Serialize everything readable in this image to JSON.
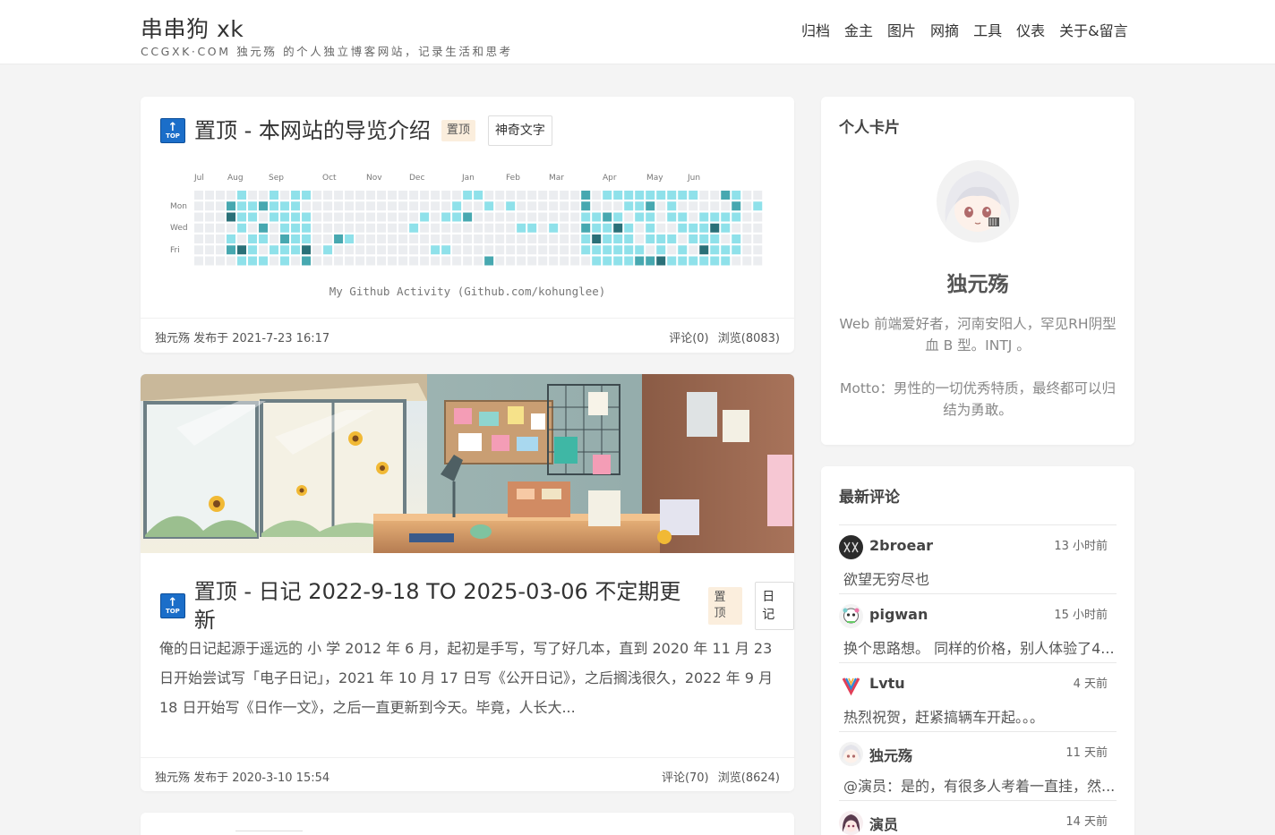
{
  "header": {
    "title": "串串狗 xk",
    "description": "CCGXK·COM 独元殇 的个人独立博客网站，记录生活和思考",
    "nav": [
      "归档",
      "金主",
      "图片",
      "网摘",
      "工具",
      "仪表",
      "关于&留言"
    ]
  },
  "posts": [
    {
      "top_icon_text": "TOP",
      "title": "置顶 - 本网站的导览介绍",
      "pin_label": "置顶",
      "tag": "神奇文字",
      "github": {
        "months": [
          "Jul",
          "Aug",
          "Sep",
          "Oct",
          "Nov",
          "Dec",
          "Jan",
          "Feb",
          "Mar",
          "Apr",
          "May",
          "Jun"
        ],
        "days": [
          "Mon",
          "Wed",
          "Fri"
        ],
        "caption": "My Github Activity (Github.com/kohunglee)",
        "colors": [
          "#ebedf0",
          "#8fe1ea",
          "#47a8b0",
          "#2a7078"
        ]
      },
      "author_line": "独元殇 发布于  2021-7-23 16:17",
      "comments": "评论(0)",
      "views": "浏览(8083)"
    },
    {
      "top_icon_text": "TOP",
      "title": "置顶 - 日记 2022-9-18 TO 2025-03-06 不定期更新",
      "pin_label": "置顶",
      "tag": "日记",
      "excerpt": "俺的日记起源于遥远的 小 学 2012 年 6 月，起初是手写，写了好几本，直到 2020 年 11 月 23 日开始尝试写「电子日记」，2021 年 10 月 17 日写《公开日记》，之后搁浅很久，2022 年 9 月 18 日开始写《日作一文》，之后一直更新到今天。毕竟，人长大...",
      "author_line": "独元殇 发布于  2020-3-10 15:54",
      "comments": "评论(70)",
      "views": "浏览(8624)"
    }
  ],
  "profile": {
    "title": "个人卡片",
    "name": "独元殇",
    "bio": "Web 前端爱好者，河南安阳人，罕见RH阴型血 B 型。INTJ 。",
    "motto": "Motto：男性的一切优秀特质，最终都可以归结为勇敢。"
  },
  "recent_comments": {
    "title": "最新评论",
    "items": [
      {
        "name": "2broear",
        "time": "13 小时前",
        "text": "欲望无穷尽也"
      },
      {
        "name": "pigwan",
        "time": "15 小时前",
        "text": "换个思路想。 同样的价格，别人体验了4..."
      },
      {
        "name": "Lvtu",
        "time": "4 天前",
        "text": "热烈祝贺，赶紧搞辆车开起。。。"
      },
      {
        "name": "独元殇",
        "time": "11 天前",
        "text": "@演员：是的，有很多人考着一直挂，然..."
      },
      {
        "name": "演员",
        "time": "14 天前",
        "text": ""
      }
    ]
  }
}
